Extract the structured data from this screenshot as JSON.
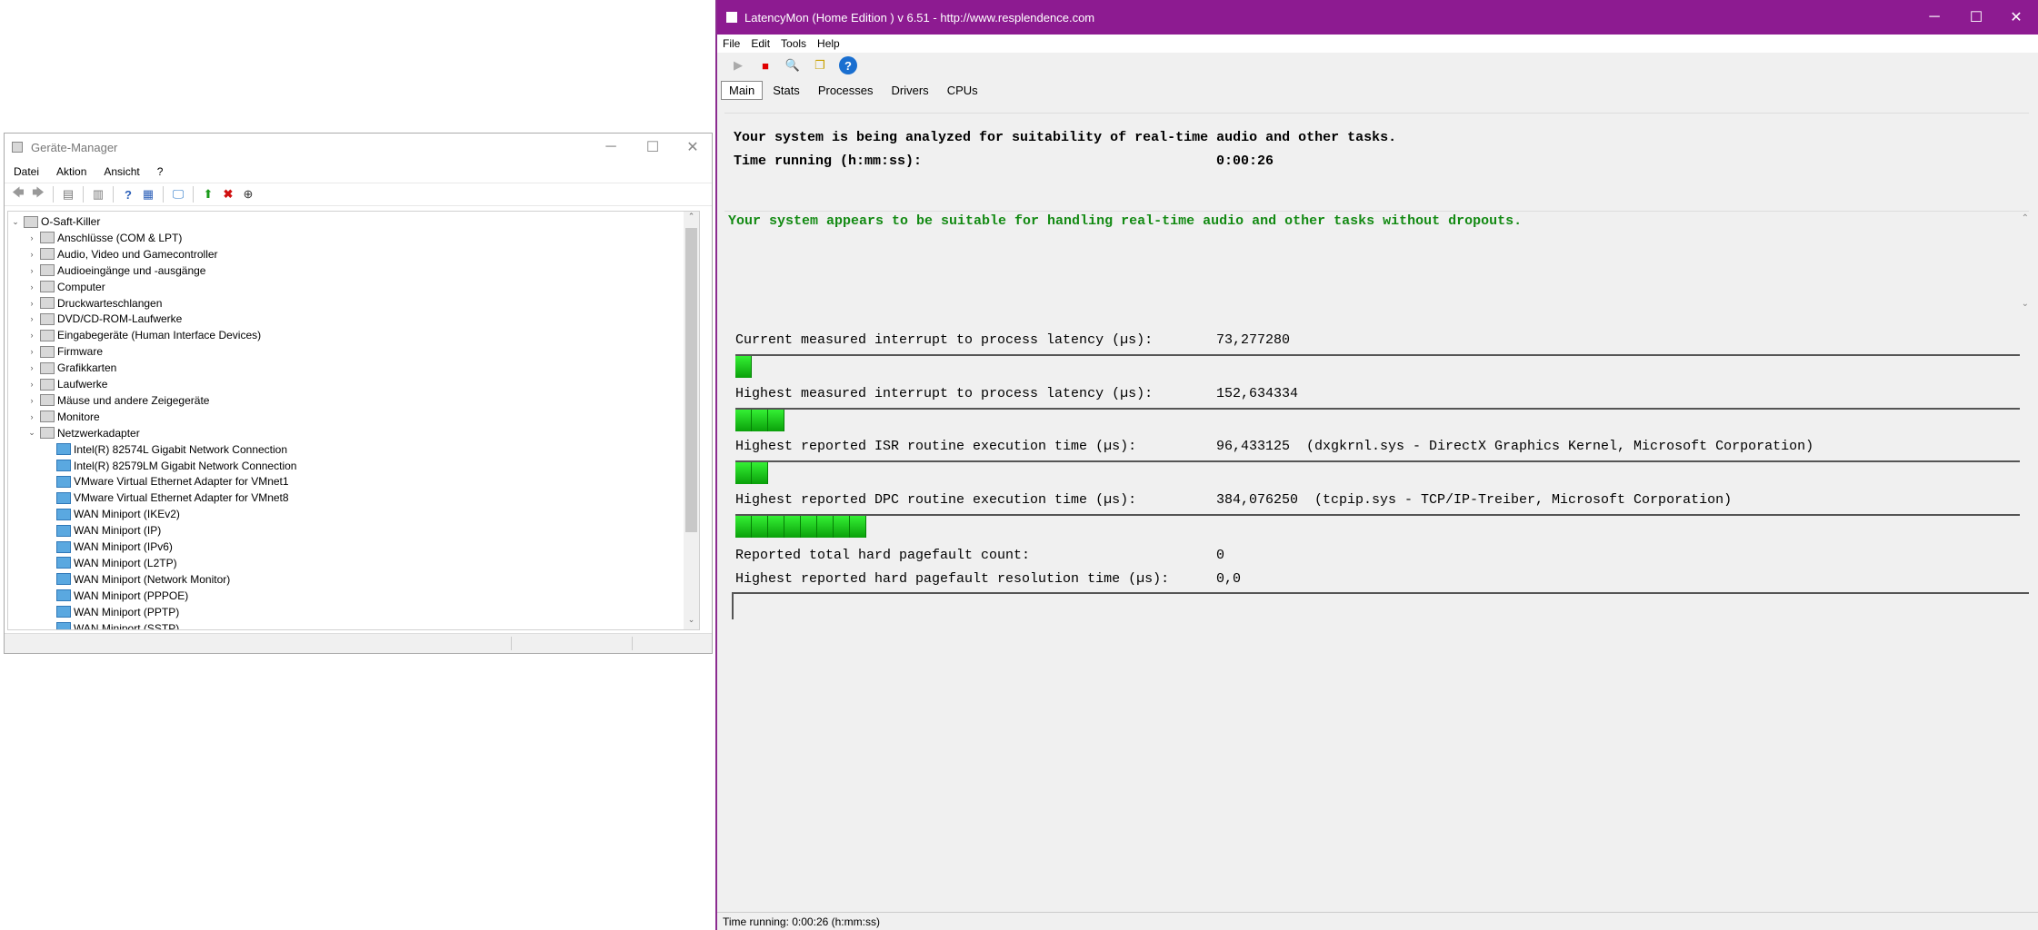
{
  "device_manager": {
    "title": "Geräte-Manager",
    "menu": [
      "Datei",
      "Aktion",
      "Ansicht",
      "?"
    ],
    "root": "O-Saft-Killer",
    "categories": [
      "Anschlüsse (COM & LPT)",
      "Audio, Video und Gamecontroller",
      "Audioeingänge und -ausgänge",
      "Computer",
      "Druckwarteschlangen",
      "DVD/CD-ROM-Laufwerke",
      "Eingabegeräte (Human Interface Devices)",
      "Firmware",
      "Grafikkarten",
      "Laufwerke",
      "Mäuse und andere Zeigegeräte",
      "Monitore",
      "Netzwerkadapter"
    ],
    "network_adapters": [
      "Intel(R) 82574L Gigabit Network Connection",
      "Intel(R) 82579LM Gigabit Network Connection",
      "VMware Virtual Ethernet Adapter for VMnet1",
      "VMware Virtual Ethernet Adapter for VMnet8",
      "WAN Miniport (IKEv2)",
      "WAN Miniport (IP)",
      "WAN Miniport (IPv6)",
      "WAN Miniport (L2TP)",
      "WAN Miniport (Network Monitor)",
      "WAN Miniport (PPPOE)",
      "WAN Miniport (PPTP)",
      "WAN Miniport (SSTP)"
    ]
  },
  "latencymon": {
    "title": "LatencyMon  (Home Edition )  v 6.51 - http://www.resplendence.com",
    "menu": [
      "File",
      "Edit",
      "Tools",
      "Help"
    ],
    "tabs": [
      "Main",
      "Stats",
      "Processes",
      "Drivers",
      "CPUs"
    ],
    "analyzing": "Your system is being analyzed for suitability of real-time audio and other tasks.",
    "time_running_label": "Time running (h:mm:ss):",
    "time_running_value": "0:00:26",
    "verdict": "Your system appears to be suitable for handling real-time audio and other tasks without dropouts.",
    "metrics": [
      {
        "label": "Current measured interrupt to process latency (µs):",
        "value": "73,277280",
        "detail": "",
        "bar_cells": 1
      },
      {
        "label": "Highest measured interrupt to process latency (µs):",
        "value": "152,634334",
        "detail": "",
        "bar_cells": 3
      },
      {
        "label": "Highest reported ISR routine execution time (µs):",
        "value": "96,433125",
        "detail": "(dxgkrnl.sys - DirectX Graphics Kernel, Microsoft Corporation)",
        "bar_cells": 2
      },
      {
        "label": "Highest reported DPC routine execution time (µs):",
        "value": "384,076250",
        "detail": "(tcpip.sys - TCP/IP-Treiber, Microsoft Corporation)",
        "bar_cells": 8
      }
    ],
    "pagefault_count_label": "Reported total hard pagefault count:",
    "pagefault_count_value": "0",
    "pagefault_time_label": "Highest reported hard pagefault resolution time (µs):",
    "pagefault_time_value": "0,0",
    "status": "Time running: 0:00:26  (h:mm:ss)",
    "colors": {
      "titlebar": "#8d1b91",
      "verdict": "#138a13",
      "bar": "#1ec81e"
    }
  }
}
